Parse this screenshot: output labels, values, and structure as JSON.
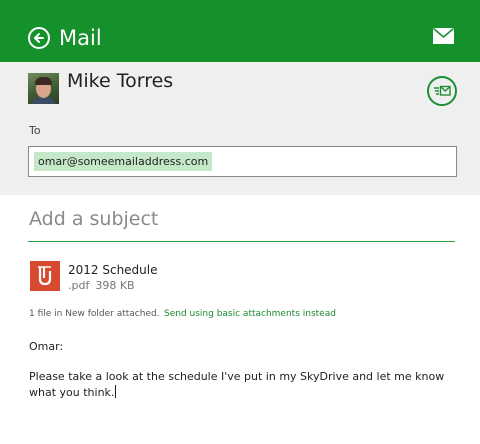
{
  "app": {
    "title": "Mail",
    "theme_color": "#15912b"
  },
  "header": {
    "sender_name": "Mike Torres",
    "to_label": "To",
    "to_recipient": "omar@someemailaddress.com"
  },
  "compose": {
    "subject_placeholder": "Add a subject",
    "attachment": {
      "name": "2012 Schedule",
      "extension": ".pdf",
      "size": "398 KB"
    },
    "attachment_info": "1 file in New folder attached.",
    "basic_attachments_link": "Send using basic attachments instead",
    "greeting": "Omar:",
    "body": "Please take a look at the schedule I've put in my SkyDrive and let me know what you think."
  },
  "icons": {
    "back": "back-arrow-icon",
    "mail": "envelope-icon",
    "send": "send-icon",
    "attachment": "pdf-file-icon"
  }
}
